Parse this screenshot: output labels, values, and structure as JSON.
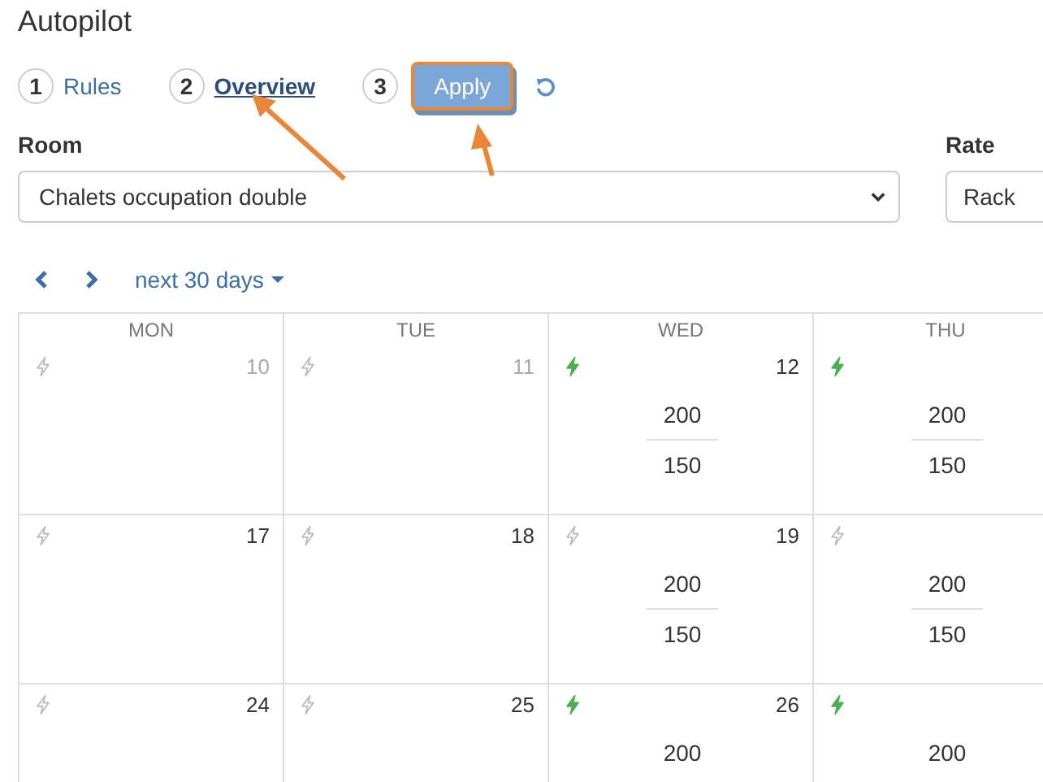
{
  "title": "Autopilot",
  "steps": [
    {
      "number": "1",
      "label": "Rules",
      "kind": "link",
      "selected": false
    },
    {
      "number": "2",
      "label": "Overview",
      "kind": "link",
      "selected": true
    },
    {
      "number": "3",
      "label": "Apply",
      "kind": "button",
      "selected": false,
      "highlighted": true
    }
  ],
  "room": {
    "label": "Room",
    "value": "Chalets occupation double"
  },
  "rate": {
    "label": "Rate",
    "value": "Rack"
  },
  "range": {
    "label": "next 30 days"
  },
  "calendar": {
    "days": [
      "MON",
      "TUE",
      "WED",
      "THU"
    ],
    "weeks": [
      [
        {
          "date": "10",
          "past": true,
          "on": false
        },
        {
          "date": "11",
          "past": true,
          "on": false
        },
        {
          "date": "12",
          "past": false,
          "on": true,
          "prices": [
            "200",
            "150"
          ]
        },
        {
          "on": true,
          "prices": [
            "200",
            "150"
          ]
        }
      ],
      [
        {
          "date": "17",
          "past": false,
          "on": false
        },
        {
          "date": "18",
          "past": false,
          "on": false
        },
        {
          "date": "19",
          "past": false,
          "on": false,
          "prices": [
            "200",
            "150"
          ]
        },
        {
          "on": false,
          "prices": [
            "200",
            "150"
          ]
        }
      ],
      [
        {
          "date": "24",
          "past": false,
          "on": false
        },
        {
          "date": "25",
          "past": false,
          "on": false
        },
        {
          "date": "26",
          "past": false,
          "on": true,
          "prices": [
            "200"
          ]
        },
        {
          "on": true,
          "prices": [
            "200"
          ]
        }
      ]
    ]
  }
}
